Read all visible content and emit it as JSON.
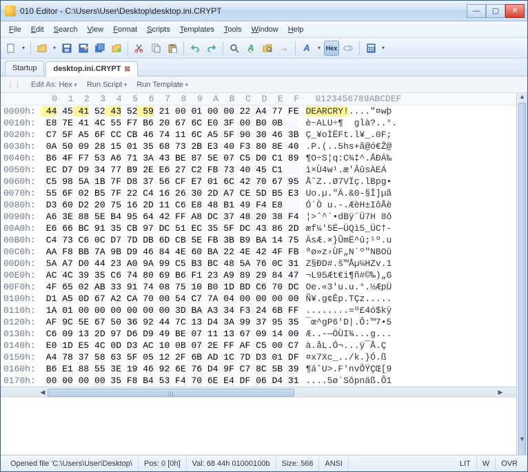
{
  "window": {
    "app_name": "010 Editor",
    "file_path": "C:\\Users\\User\\Desktop\\desktop.ini.CRYPT",
    "title": "010 Editor - C:\\Users\\User\\Desktop\\desktop.ini.CRYPT"
  },
  "menu": [
    "File",
    "Edit",
    "Search",
    "View",
    "Format",
    "Scripts",
    "Templates",
    "Tools",
    "Window",
    "Help"
  ],
  "tabs": [
    {
      "label": "Startup",
      "active": false
    },
    {
      "label": "desktop.ini.CRYPT",
      "active": true
    }
  ],
  "subtoolbar": {
    "edit_as_label": "Edit As:",
    "edit_as_value": "Hex",
    "run_script": "Run Script",
    "run_template": "Run Template"
  },
  "hex": {
    "header_cols": " 0  1  2  3  4  5  6  7  8  9  A  B  C  D  E  F",
    "ascii_header": "0123456789ABCDEF",
    "highlight_row": 0,
    "highlight_len": 8,
    "rows": [
      {
        "addr": "0000h:",
        "bytes": [
          "44",
          "45",
          "41",
          "52",
          "43",
          "52",
          "59",
          "21",
          "00",
          "01",
          "00",
          "00",
          "22",
          "A4",
          "77",
          "FE"
        ],
        "ascii": "DEARCRY!....\"¤wþ"
      },
      {
        "addr": "0010h:",
        "bytes": [
          "E8",
          "7E",
          "41",
          "4C",
          "55",
          "F7",
          "B6",
          "20",
          "67",
          "6C",
          "E0",
          "3F",
          "00",
          "B0",
          "0B"
        ],
        "ascii": "è~ALU÷¶  glà?..°."
      },
      {
        "addr": "0020h:",
        "bytes": [
          "C7",
          "5F",
          "A5",
          "6F",
          "CC",
          "CB",
          "46",
          "74",
          "11",
          "6C",
          "A5",
          "5F",
          "90",
          "30",
          "46",
          "3B"
        ],
        "ascii": "Ç_¥oÌËFt.l¥_.0F;"
      },
      {
        "addr": "0030h:",
        "bytes": [
          "0A",
          "50",
          "09",
          "28",
          "15",
          "01",
          "35",
          "68",
          "73",
          "2B",
          "E3",
          "40",
          "F3",
          "80",
          "8E",
          "40"
        ],
        "ascii": ".P.(..5hs+ã@ó€Ž@"
      },
      {
        "addr": "0040h:",
        "bytes": [
          "B6",
          "4F",
          "F7",
          "53",
          "A6",
          "71",
          "3A",
          "43",
          "BE",
          "87",
          "5E",
          "07",
          "C5",
          "D0",
          "C1",
          "89"
        ],
        "ascii": "¶O÷S¦q:C¾‡^.ÅÐÁ‰"
      },
      {
        "addr": "0050h:",
        "bytes": [
          "EC",
          "D7",
          "D9",
          "34",
          "77",
          "B9",
          "2E",
          "E6",
          "27",
          "C2",
          "FB",
          "73",
          "40",
          "45",
          "C1"
        ],
        "ascii": "ì×Ù4w¹.æ'ÂûsÀEÁ"
      },
      {
        "addr": "0060h:",
        "bytes": [
          "C5",
          "98",
          "5A",
          "1B",
          "7F",
          "D8",
          "37",
          "56",
          "CF",
          "E7",
          "01",
          "6C",
          "42",
          "70",
          "67",
          "95"
        ],
        "ascii": "Å˜Z..Ø7VÏç.lBpg•"
      },
      {
        "addr": "0070h:",
        "bytes": [
          "55",
          "6F",
          "02",
          "B5",
          "7F",
          "22",
          "C4",
          "16",
          "26",
          "30",
          "2D",
          "A7",
          "CE",
          "5D",
          "B5",
          "E3"
        ],
        "ascii": "Uo.µ.\"Ä.&0-§Î]µã"
      },
      {
        "addr": "0080h:",
        "bytes": [
          "D3",
          "60",
          "D2",
          "20",
          "75",
          "16",
          "2D",
          "11",
          "C6",
          "E8",
          "48",
          "B1",
          "49",
          "F4",
          "E8"
        ],
        "ascii": "Ó`Ò u.-.ÆèH±IôÅè"
      },
      {
        "addr": "0090h:",
        "bytes": [
          "A6",
          "3E",
          "88",
          "5E",
          "B4",
          "95",
          "64",
          "42",
          "FF",
          "A8",
          "DC",
          "37",
          "48",
          "20",
          "38",
          "F4"
        ],
        "ascii": "¦>ˆ^´•dBÿ¨Ü7H 8ô"
      },
      {
        "addr": "00A0h:",
        "bytes": [
          "E6",
          "66",
          "BC",
          "91",
          "35",
          "CB",
          "97",
          "DC",
          "51",
          "EC",
          "35",
          "5F",
          "DC",
          "43",
          "86",
          "2D"
        ],
        "ascii": "æf¼'5Ë—ÜQì5_ÜC†-"
      },
      {
        "addr": "00B0h:",
        "bytes": [
          "C4",
          "73",
          "C6",
          "0C",
          "D7",
          "7D",
          "DB",
          "6D",
          "CB",
          "5E",
          "FB",
          "3B",
          "B9",
          "BA",
          "14",
          "75"
        ],
        "ascii": "ÄsÆ.×}ÛmË^û;¹º.u"
      },
      {
        "addr": "00C0h:",
        "bytes": [
          "AA",
          "F8",
          "BB",
          "7A",
          "9B",
          "D9",
          "46",
          "84",
          "4E",
          "60",
          "BA",
          "22",
          "4E",
          "42",
          "4F",
          "FB"
        ],
        "ascii": "ªø»z›ÙF„N`º\"NBOû"
      },
      {
        "addr": "00D0h:",
        "bytes": [
          "5A",
          "A7",
          "D0",
          "44",
          "23",
          "A0",
          "9A",
          "99",
          "C5",
          "B3",
          "BC",
          "48",
          "5A",
          "76",
          "0C",
          "31"
        ],
        "ascii": "Z§ÐD#.š™Åµ¼HZv.1"
      },
      {
        "addr": "00E0h:",
        "bytes": [
          "AC",
          "4C",
          "39",
          "35",
          "C6",
          "74",
          "80",
          "69",
          "B6",
          "F1",
          "23",
          "A9",
          "89",
          "29",
          "84",
          "47"
        ],
        "ascii": "¬L95Æt€i¶ñ#©‰)„G"
      },
      {
        "addr": "00F0h:",
        "bytes": [
          "4F",
          "65",
          "02",
          "AB",
          "33",
          "91",
          "74",
          "08",
          "75",
          "10",
          "B0",
          "1D",
          "BD",
          "C6",
          "70",
          "DC"
        ],
        "ascii": "Oe.«3'u.u.°.½ÆpÜ"
      },
      {
        "addr": "0100h:",
        "bytes": [
          "D1",
          "A5",
          "0D",
          "67",
          "A2",
          "CA",
          "70",
          "00",
          "54",
          "C7",
          "7A",
          "04",
          "00",
          "00",
          "00",
          "00"
        ],
        "ascii": "Ñ¥.g¢Êp.TÇz....."
      },
      {
        "addr": "0110h:",
        "bytes": [
          "1A",
          "01",
          "00",
          "00",
          "00",
          "00",
          "00",
          "00",
          "3D",
          "BA",
          "A3",
          "34",
          "F3",
          "24",
          "6B",
          "FF"
        ],
        "ascii": "........=º£4ó$kÿ"
      },
      {
        "addr": "0120h:",
        "bytes": [
          "AF",
          "9C",
          "5E",
          "67",
          "50",
          "36",
          "92",
          "44",
          "7C",
          "13",
          "D4",
          "3A",
          "99",
          "37",
          "95",
          "35"
        ],
        "ascii": "¯œ^gP6'D|.Ô:™7•5"
      },
      {
        "addr": "0130h:",
        "bytes": [
          "C6",
          "09",
          "13",
          "2D",
          "97",
          "D6",
          "D9",
          "49",
          "BE",
          "07",
          "11",
          "13",
          "67",
          "09",
          "14",
          "00"
        ],
        "ascii": "Æ..-—ÖÙI¾...g..."
      },
      {
        "addr": "0140h:",
        "bytes": [
          "E0",
          "1D",
          "E5",
          "4C",
          "0D",
          "D3",
          "AC",
          "10",
          "0B",
          "07",
          "2E",
          "FF",
          "AF",
          "C5",
          "00",
          "C7"
        ],
        "ascii": "à.åL.Ó¬...ÿ¯Å.Ç"
      },
      {
        "addr": "0150h:",
        "bytes": [
          "A4",
          "78",
          "37",
          "58",
          "63",
          "5F",
          "05",
          "12",
          "2F",
          "6B",
          "AD",
          "1C",
          "7D",
          "D3",
          "01",
          "DF"
        ],
        "ascii": "¤x7Xc_../k­.}Ó.ß"
      },
      {
        "addr": "0160h:",
        "bytes": [
          "B6",
          "E1",
          "88",
          "55",
          "3E",
          "19",
          "46",
          "92",
          "6E",
          "76",
          "D4",
          "9F",
          "C7",
          "8C",
          "5B",
          "39"
        ],
        "ascii": "¶áˆU>.F'nvÔŸÇŒ[9"
      },
      {
        "addr": "0170h:",
        "bytes": [
          "00",
          "00",
          "00",
          "00",
          "35",
          "F8",
          "B4",
          "53",
          "F4",
          "70",
          "6E",
          "E4",
          "DF",
          "06",
          "D4",
          "31"
        ],
        "ascii": "....5ø´Sôpnäß.Ô1"
      }
    ]
  },
  "statusbar": {
    "opened": "Opened file 'C:\\Users\\User\\Desktop\\",
    "pos": "Pos: 0 [0h]",
    "val": "Val: 68 44h 01000100b",
    "size": "Size: 568",
    "enc": "ANSI",
    "endian": "LIT",
    "wrap": "W",
    "ovr": "OVR"
  },
  "icons": {
    "new": "🗎",
    "open": "📂",
    "save": "💾",
    "saveall": "💾",
    "cut": "✂",
    "copy": "📋",
    "paste": "📄",
    "undo": "↶",
    "redo": "↷",
    "find": "🔍",
    "hex": "Hex",
    "calc": "🖩"
  }
}
